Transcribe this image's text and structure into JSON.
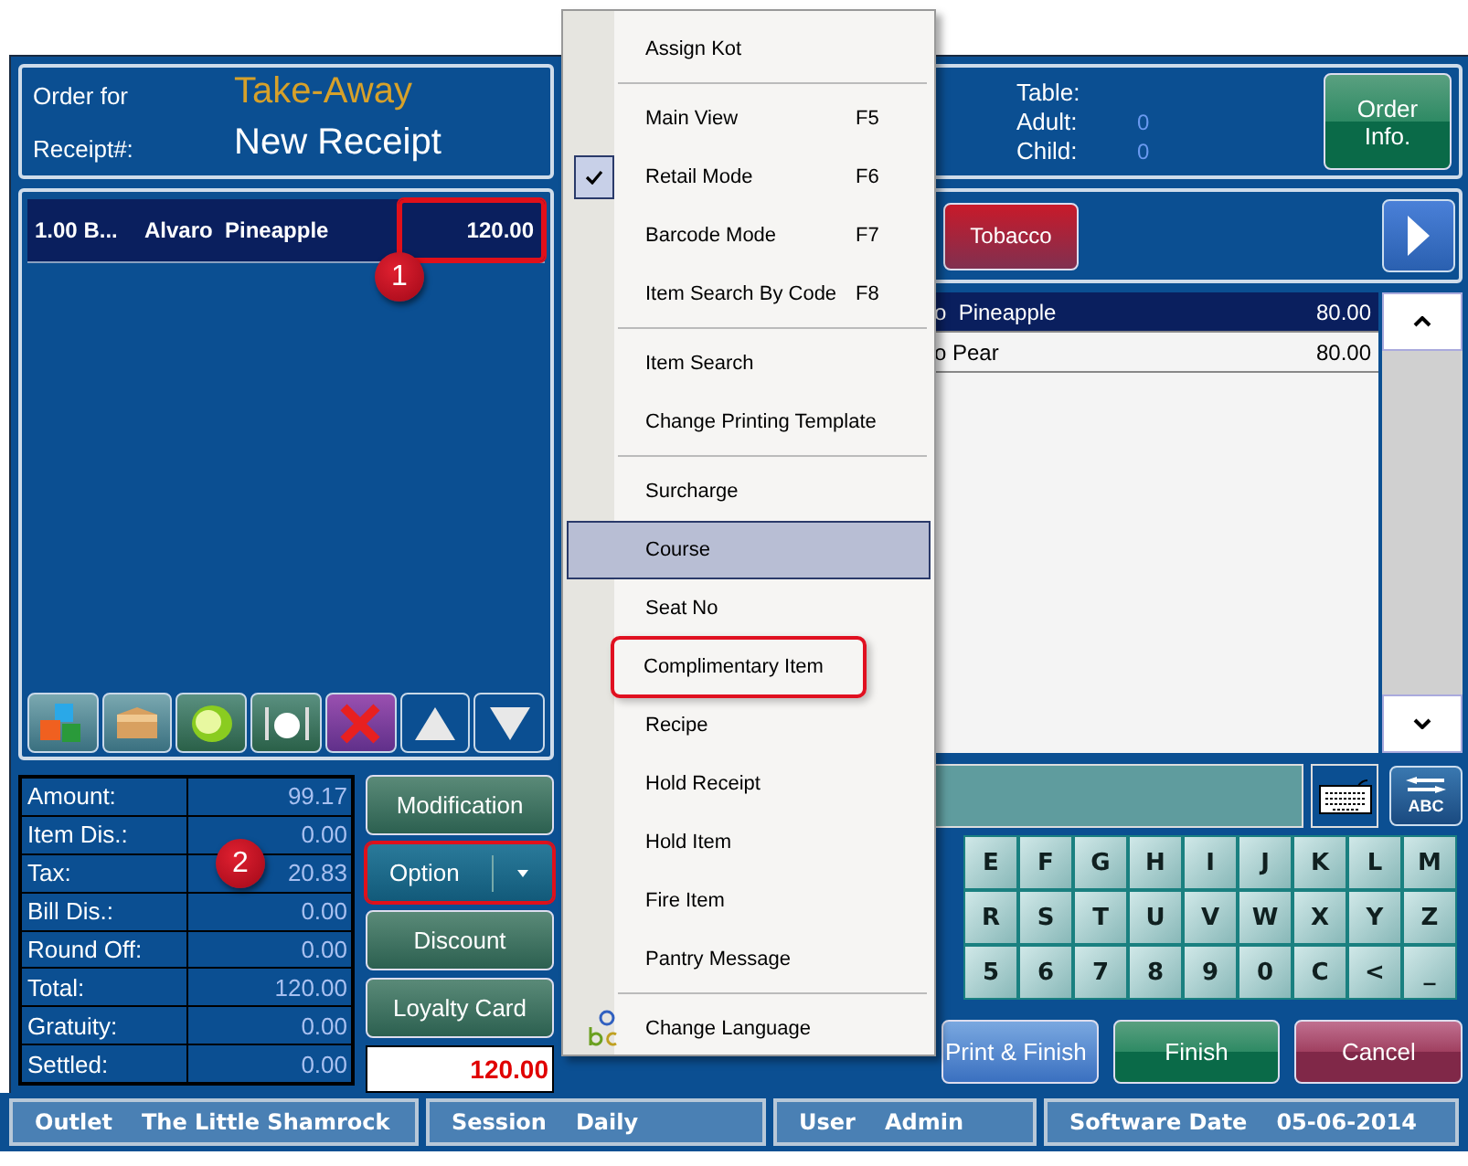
{
  "order": {
    "label": "Order for",
    "type": "Take-Away",
    "receipt_label": "Receipt#:",
    "receipt": "New Receipt"
  },
  "order_items": [
    {
      "qty": "1.00 B...",
      "name": "Alvaro  Pineapple",
      "price": "120.00",
      "selected": true,
      "callout": true
    }
  ],
  "toolbar": [
    {
      "kind": "cubes"
    },
    {
      "kind": "box"
    },
    {
      "kind": "lime"
    },
    {
      "kind": "plate"
    },
    {
      "kind": "delete"
    },
    {
      "kind": "up"
    },
    {
      "kind": "down"
    }
  ],
  "totals": [
    {
      "label": "Amount:",
      "value": "99.17"
    },
    {
      "label": "Item Dis.:",
      "value": "0.00"
    },
    {
      "label": "Tax:",
      "value": "20.83"
    },
    {
      "label": "Bill Dis.:",
      "value": "0.00"
    },
    {
      "label": "Round Off:",
      "value": "0.00"
    },
    {
      "label": "Total:",
      "value": "120.00"
    },
    {
      "label": "Gratuity:",
      "value": "0.00"
    },
    {
      "label": "Settled:",
      "value": "0.00"
    }
  ],
  "actions": [
    {
      "label": "Modification",
      "kind": "plain",
      "callout": false
    },
    {
      "label": "Option",
      "kind": "split",
      "callout": true
    },
    {
      "label": "Discount",
      "kind": "plain",
      "callout": false
    },
    {
      "label": "Loyalty Card",
      "kind": "plain",
      "callout": false
    }
  ],
  "due": "120.00",
  "table_info": {
    "table_label": "Table:",
    "adult_label": "Adult:",
    "adult": "0",
    "child_label": "Child:",
    "child": "0",
    "button": "Order Info."
  },
  "categories": [
    {
      "label": "Tobacco"
    }
  ],
  "products": [
    {
      "name": "o  Pineapple",
      "price": "80.00",
      "selected": true
    },
    {
      "name": "o Pear",
      "price": "80.00",
      "selected": false
    }
  ],
  "keyboard": [
    "E",
    "F",
    "G",
    "H",
    "I",
    "J",
    "K",
    "L",
    "M",
    "R",
    "S",
    "T",
    "U",
    "V",
    "W",
    "X",
    "Y",
    "Z",
    "5",
    "6",
    "7",
    "8",
    "9",
    "0",
    "C",
    "<",
    "_"
  ],
  "keyboard_toggle": "ABC",
  "footer_buttons": [
    {
      "label": "Print & Finish",
      "kind": "print"
    },
    {
      "label": "Finish",
      "kind": "finish"
    },
    {
      "label": "Cancel",
      "kind": "cancel"
    }
  ],
  "status_bar": [
    {
      "label": "Outlet",
      "value": "The Little Shamrock"
    },
    {
      "label": "Session",
      "value": "Daily"
    },
    {
      "label": "User",
      "value": "Admin"
    },
    {
      "label": "Software Date",
      "value": "05-06-2014"
    }
  ],
  "context_menu": {
    "groups": [
      [
        {
          "label": "Assign Kot",
          "kind": "item",
          "checked": false,
          "selected": false,
          "callout": false
        }
      ],
      [
        {
          "label": "Main View",
          "shortcut": "F5",
          "kind": "item",
          "checked": false,
          "selected": false,
          "callout": false
        },
        {
          "label": "Retail Mode",
          "shortcut": "F6",
          "kind": "item",
          "checked": true,
          "selected": false,
          "callout": false
        },
        {
          "label": "Barcode Mode",
          "shortcut": "F7",
          "kind": "item",
          "checked": false,
          "selected": false,
          "callout": false
        },
        {
          "label": "Item Search By Code",
          "shortcut": "F8",
          "kind": "item",
          "checked": false,
          "selected": false,
          "callout": false
        }
      ],
      [
        {
          "label": "Item Search",
          "kind": "item",
          "checked": false,
          "selected": false,
          "callout": false
        },
        {
          "label": "Change Printing Template",
          "kind": "item",
          "checked": false,
          "selected": false,
          "callout": false
        }
      ],
      [
        {
          "label": "Surcharge",
          "kind": "item",
          "checked": false,
          "selected": false,
          "callout": false
        },
        {
          "label": "Course",
          "kind": "item",
          "checked": false,
          "selected": true,
          "callout": false
        },
        {
          "label": "Seat No",
          "kind": "item",
          "checked": false,
          "selected": false,
          "callout": false
        },
        {
          "label": "Complimentary Item",
          "kind": "item",
          "checked": false,
          "selected": false,
          "callout": true
        },
        {
          "label": "Recipe",
          "kind": "item",
          "checked": false,
          "selected": false,
          "callout": false
        },
        {
          "label": "Hold Receipt",
          "kind": "item",
          "checked": false,
          "selected": false,
          "callout": false
        },
        {
          "label": "Hold Item",
          "kind": "item",
          "checked": false,
          "selected": false,
          "callout": false
        },
        {
          "label": "Fire Item",
          "kind": "item",
          "checked": false,
          "selected": false,
          "callout": false
        },
        {
          "label": "Pantry Message",
          "kind": "item",
          "checked": false,
          "selected": false,
          "callout": false
        }
      ],
      [
        {
          "label": "Change Language",
          "kind": "language",
          "checked": false,
          "selected": false,
          "callout": false
        }
      ]
    ]
  },
  "annotations": [
    {
      "number": "1"
    },
    {
      "number": "2"
    }
  ]
}
